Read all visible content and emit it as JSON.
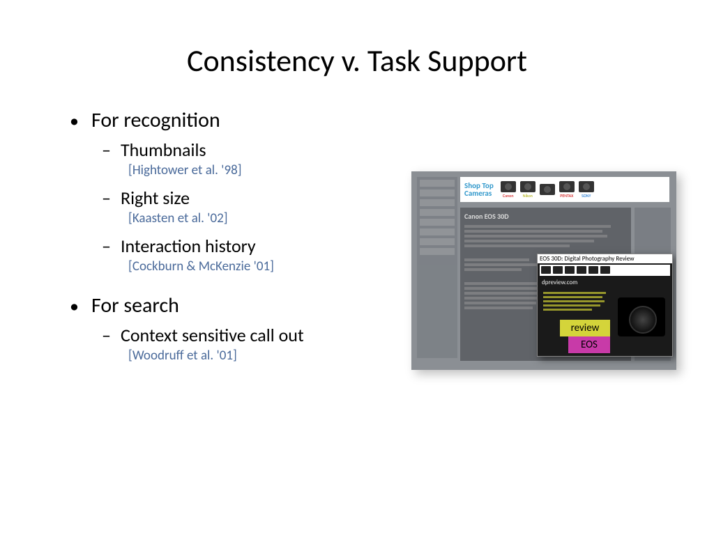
{
  "title": "Consistency v. Task Support",
  "sections": [
    {
      "heading": "For recognition",
      "items": [
        {
          "label": "Thumbnails",
          "citation": "[Hightower et al. '98]"
        },
        {
          "label": "Right size",
          "citation": "[Kaasten et al. '02]"
        },
        {
          "label": "Interaction history",
          "citation": "[Cockburn & McKenzie '01]"
        }
      ]
    },
    {
      "heading": "For search",
      "items": [
        {
          "label": "Context sensitive call out",
          "citation": "[Woodruff et al. '01]"
        }
      ]
    }
  ],
  "figure": {
    "shop_label": "Shop Top\nCameras",
    "brands": [
      "Canon",
      "Nikon",
      "",
      "PENTAX",
      "SONY"
    ],
    "main_heading": "Canon EOS 30D",
    "callout_title": "EOS 30D: Digital Photography Review",
    "callout_site": "dpreview.com",
    "highlight1": "review",
    "highlight2": "EOS"
  }
}
